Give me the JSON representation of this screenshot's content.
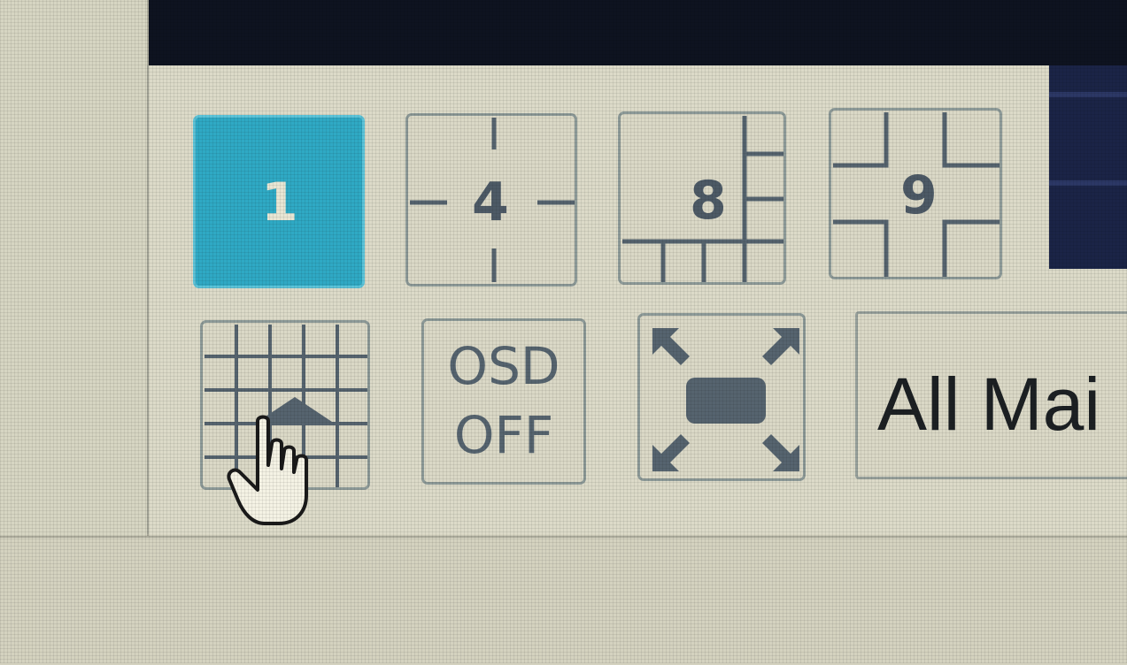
{
  "layout_buttons": [
    {
      "label": "1",
      "icon": "single-view-icon",
      "selected": true
    },
    {
      "label": "4",
      "icon": "quad-view-icon",
      "selected": false
    },
    {
      "label": "8",
      "icon": "eight-view-icon",
      "selected": false
    },
    {
      "label": "9",
      "icon": "nine-view-icon",
      "selected": false
    }
  ],
  "tools": {
    "custom_layout_icon": "grid-select-icon",
    "osd": {
      "line1": "OSD",
      "line2": "OFF"
    },
    "fullscreen_icon": "fullscreen-expand-icon",
    "stream_select": "All Mai"
  },
  "colors": {
    "accent": "#2fa9c4",
    "panel": "#dcdac8",
    "icon": "#56646f"
  }
}
